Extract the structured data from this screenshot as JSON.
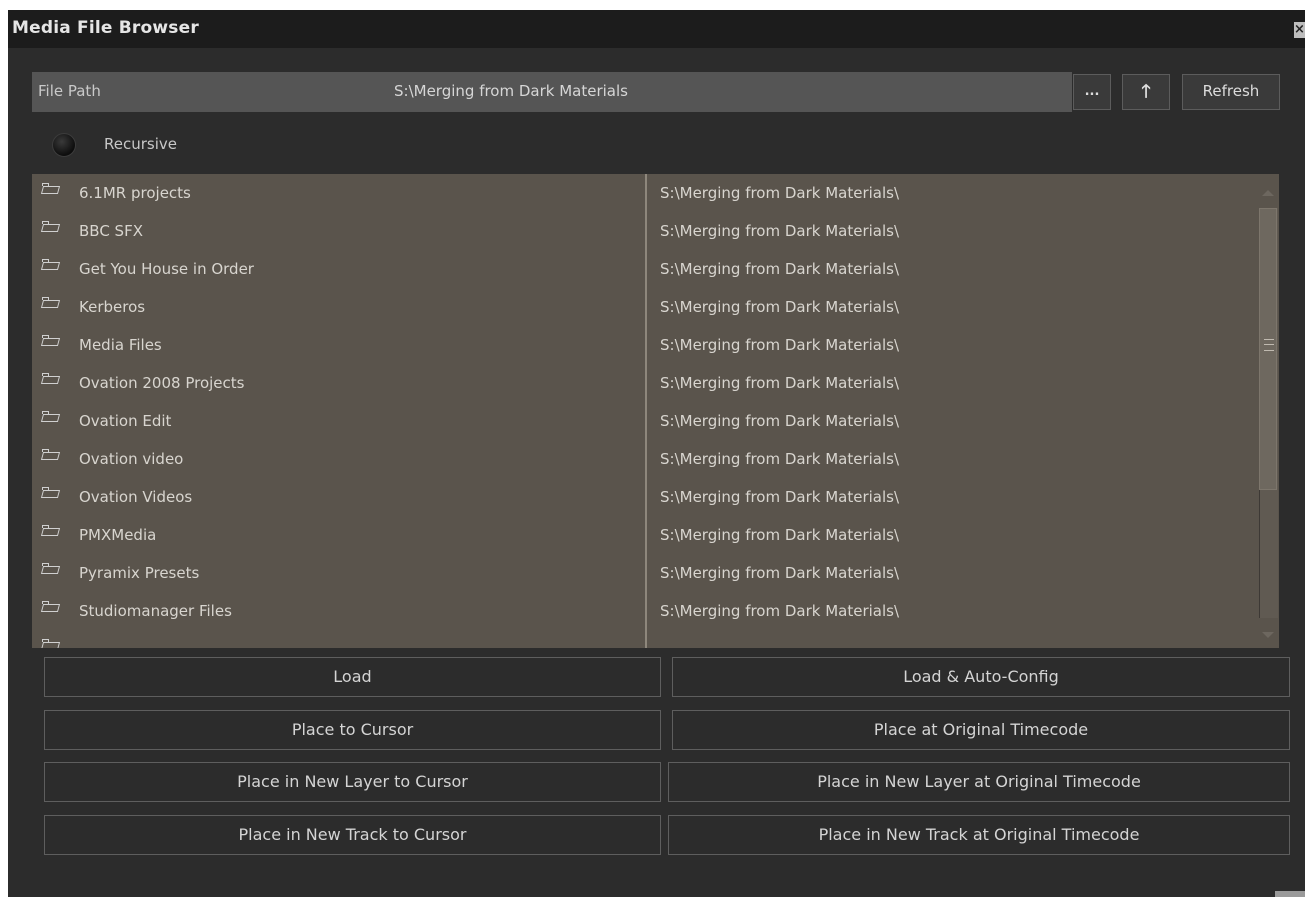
{
  "window": {
    "title": "Media File Browser",
    "close_glyph": "×"
  },
  "path_bar": {
    "label": "File Path",
    "value": "S:\\Merging from Dark Materials",
    "browse_label": "...",
    "up_icon": "up-arrow-icon",
    "up_glyph": "🡑",
    "refresh_label": "Refresh"
  },
  "recursive": {
    "label": "Recursive",
    "checked": false
  },
  "file_list": {
    "rows": [
      {
        "name": "6.1MR projects",
        "path": "S:\\Merging from Dark Materials\\"
      },
      {
        "name": "BBC SFX",
        "path": "S:\\Merging from Dark Materials\\"
      },
      {
        "name": "Get You House in Order",
        "path": "S:\\Merging from Dark Materials\\"
      },
      {
        "name": "Kerberos",
        "path": "S:\\Merging from Dark Materials\\"
      },
      {
        "name": "Media Files",
        "path": "S:\\Merging from Dark Materials\\"
      },
      {
        "name": "Ovation 2008 Projects",
        "path": "S:\\Merging from Dark Materials\\"
      },
      {
        "name": "Ovation Edit",
        "path": "S:\\Merging from Dark Materials\\"
      },
      {
        "name": "Ovation video",
        "path": "S:\\Merging from Dark Materials\\"
      },
      {
        "name": "Ovation Videos",
        "path": "S:\\Merging from Dark Materials\\"
      },
      {
        "name": "PMXMedia",
        "path": "S:\\Merging from Dark Materials\\"
      },
      {
        "name": "Pyramix Presets",
        "path": "S:\\Merging from Dark Materials\\"
      },
      {
        "name": "Studiomanager Files",
        "path": "S:\\Merging from Dark Materials\\"
      },
      {
        "name": "",
        "path": ""
      }
    ]
  },
  "actions": {
    "load": "Load",
    "load_auto_config": "Load & Auto-Config",
    "place_to_cursor": "Place to Cursor",
    "place_at_original_timecode": "Place at Original Timecode",
    "place_new_layer_cursor": "Place in New Layer to Cursor",
    "place_new_layer_timecode": "Place in  New Layer at Original Timecode",
    "place_new_track_cursor": "Place in New Track to Cursor",
    "place_new_track_timecode": "Place in New Track at Original Timecode"
  },
  "colors": {
    "window_bg": "#2c2c2c",
    "titlebar_bg": "#1c1c1c",
    "list_bg": "#5a544c",
    "path_bar_bg": "#555555"
  }
}
